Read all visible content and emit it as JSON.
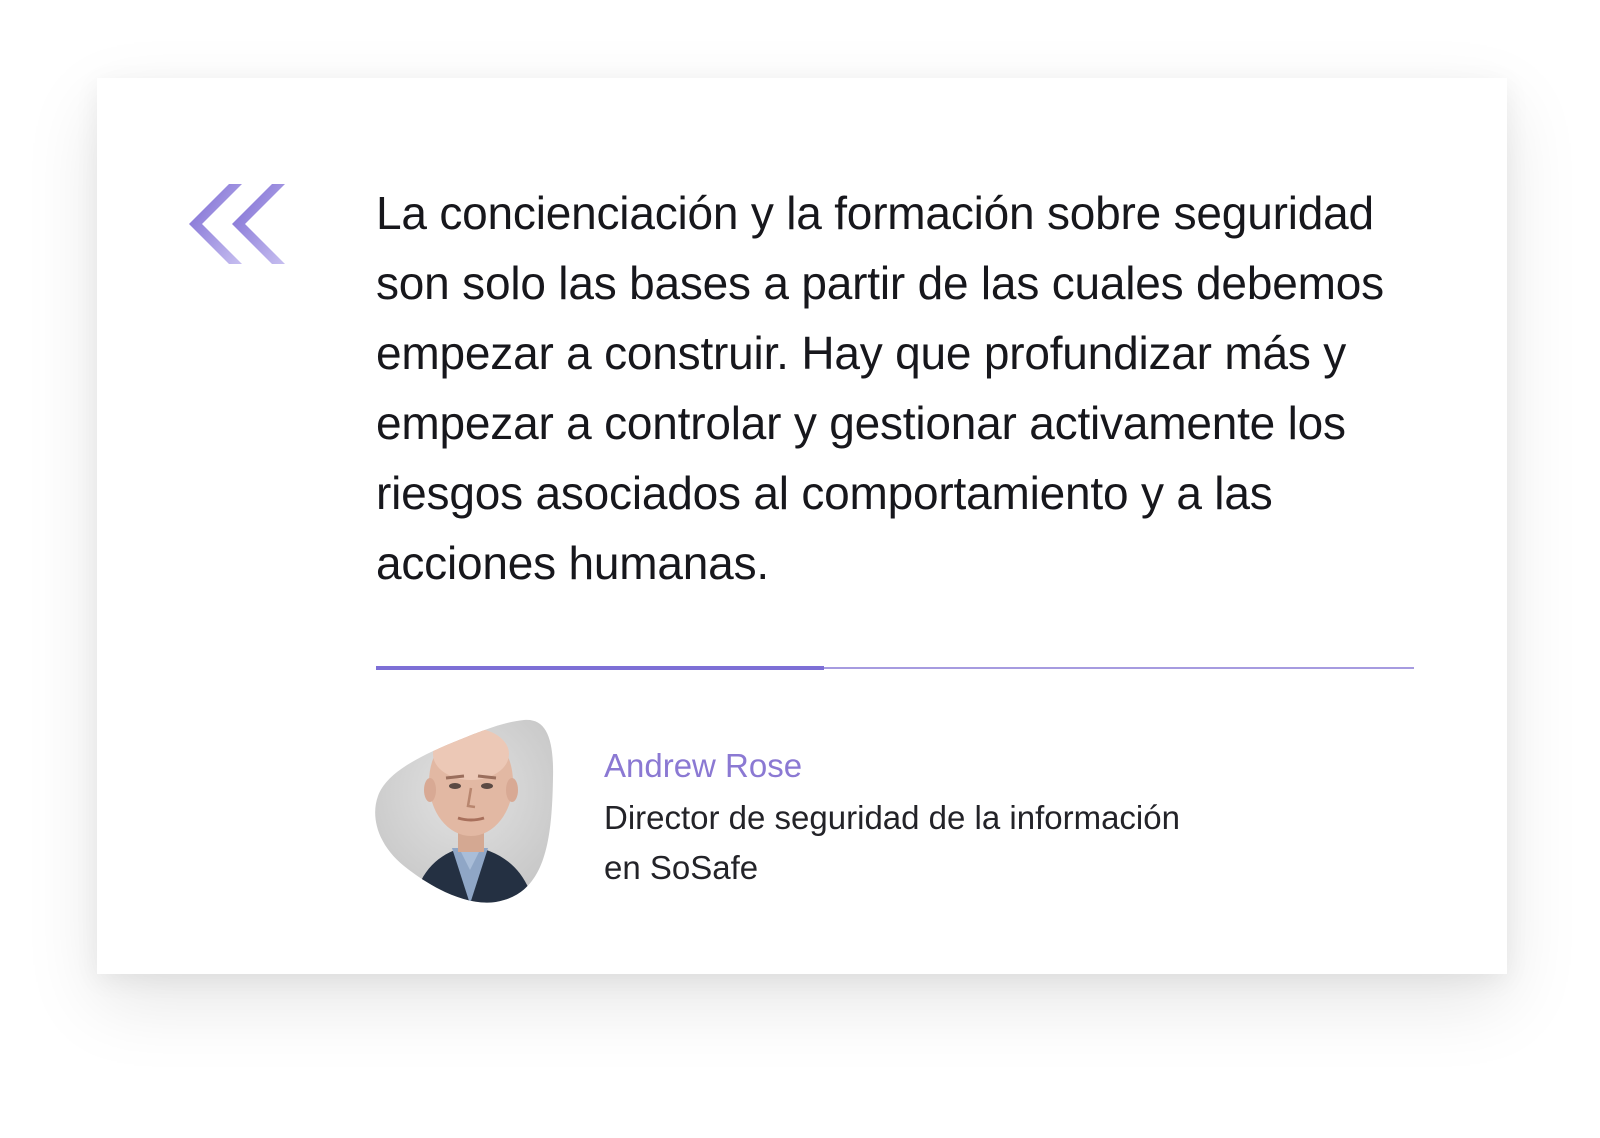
{
  "quote": {
    "text": "La concienciación y la formación sobre seguridad son solo las bases a partir de las cuales debemos empezar a construir. Hay que profundizar más y empezar a controlar y gestionar activamente los riesgos asociados al comportamiento y a las acciones humanas."
  },
  "author": {
    "name": "Andrew Rose",
    "role_line1": "Director de seguridad de la información",
    "role_line2": "en SoSafe"
  },
  "colors": {
    "accent": "#8b79d3",
    "accent_dark": "#7d6fd6",
    "accent_light": "#a69be0",
    "text": "#17171c"
  },
  "icons": {
    "quote_mark": "double-chevron-quote-icon",
    "avatar": "person-photo"
  }
}
